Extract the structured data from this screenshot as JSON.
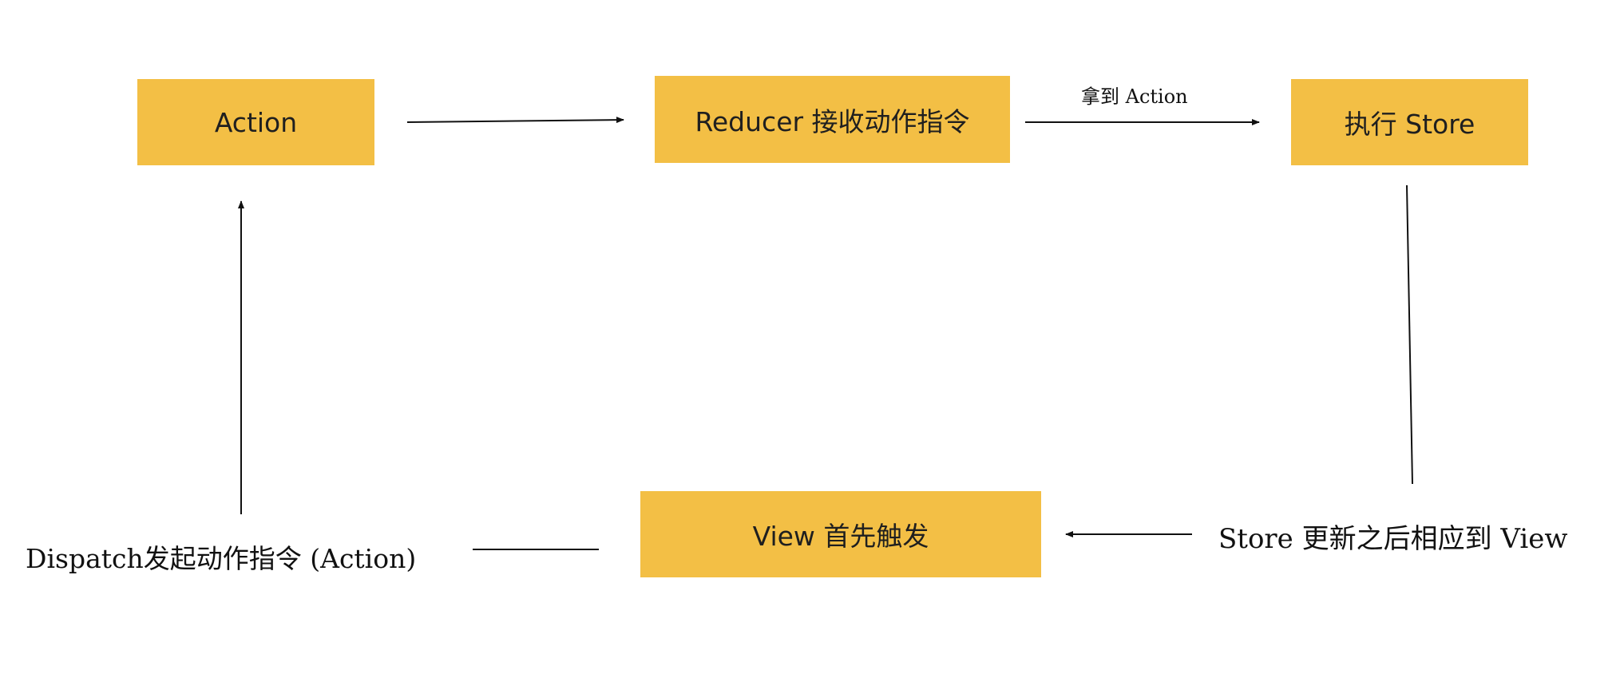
{
  "nodes": {
    "action": "Action",
    "reducer": "Reducer 接收动作指令",
    "store": "执行 Store",
    "view": "View 首先触发"
  },
  "edge_labels": {
    "reducer_to_store": "拿到 Action",
    "store_to_view": "Store 更新之后相应到 View",
    "view_to_action": "Dispatch发起动作指令 (Action)"
  }
}
